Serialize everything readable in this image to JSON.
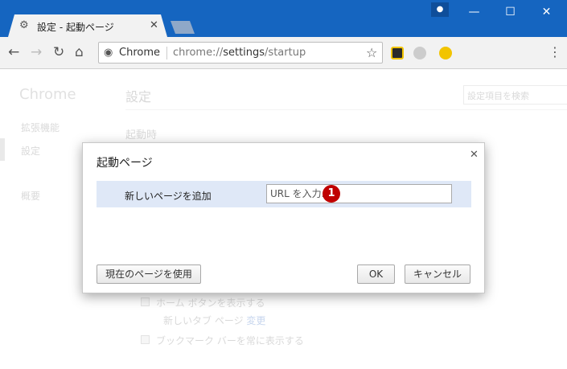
{
  "window": {
    "tab_title": "設定 - 起動ページ",
    "tab_icon": "gear-icon",
    "controls": [
      "minimize-icon",
      "maximize-icon",
      "close-icon"
    ],
    "profile_icon": "person-icon"
  },
  "toolbar": {
    "omnibox_label": "Chrome",
    "url_prefix": "chrome://",
    "url_path": "settings",
    "url_suffix": "/startup",
    "extensions": [
      {
        "name": "ext-target-icon",
        "color": "#2b2b2b"
      },
      {
        "name": "ext-ghost-icon",
        "color": "#9e9e9e"
      },
      {
        "name": "ext-search-icon",
        "color": "#f2c400"
      }
    ]
  },
  "settings_page": {
    "sidebar_title": "Chrome",
    "sidebar_items": [
      "拡張機能",
      "設定",
      "概要"
    ],
    "title": "設定",
    "search_placeholder": "設定項目を検索",
    "section_startup": "起動時",
    "show_home_button": "ホーム ボタンを表示する",
    "home_page_text": "新しいタブ ページ",
    "home_page_change": "変更",
    "show_bookmarks_bar": "ブックマーク バーを常に表示する"
  },
  "dialog": {
    "title": "起動ページ",
    "row_label": "新しいページを追加",
    "url_placeholder": "URL を入力...",
    "callout_number": "1",
    "use_current_button": "現在のページを使用",
    "ok_button": "OK",
    "cancel_button": "キャンセル"
  },
  "colors": {
    "titlebar": "#1565c0",
    "dialog_row_highlight": "#dfe8f7",
    "callout_badge": "#c00000"
  }
}
